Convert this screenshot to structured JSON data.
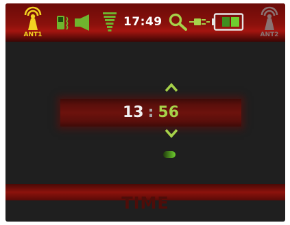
{
  "status_bar": {
    "antenna_left_label": "ANT1",
    "antenna_right_label": "ANT2",
    "clock": "17:49",
    "icons": [
      "antenna-icon",
      "phone-vibrate-icon",
      "speaker-icon",
      "signal-strength-icon",
      "search-icon",
      "plug-icon",
      "battery-icon"
    ],
    "battery_level": 0.67
  },
  "time_setter": {
    "hours": "13",
    "separator": ":",
    "minutes": "56",
    "up_icon": "chevron-up-icon",
    "down_icon": "chevron-down-icon"
  },
  "footer": {
    "title": "TIME"
  },
  "colors": {
    "accent_yellow": "#f2d321",
    "accent_green": "#a6d24a",
    "header_red": "#8a110c",
    "background": "#1f1f1f"
  }
}
